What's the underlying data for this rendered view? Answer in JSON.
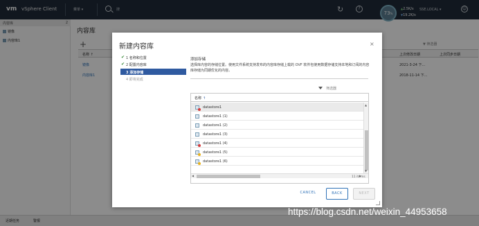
{
  "topbar": {
    "logo": "vm",
    "product": "vSphere Client",
    "menu": "菜单 ▾",
    "search_placeholder": "搜",
    "user": "SSE.LOCAL ▾",
    "help": "?",
    "refresh": "↻",
    "smiley": "☺"
  },
  "netmon": {
    "percent": "73",
    "percent_unit": "%",
    "up": "2.5K/s",
    "down": "19.2K/s"
  },
  "leftpanel": {
    "header": "内容库",
    "count": "2",
    "items": [
      {
        "label": "镜像"
      },
      {
        "label": "内容库1"
      }
    ]
  },
  "main": {
    "title": "内容库",
    "plus": "+",
    "filter": "▼ 筛选器",
    "columns": [
      "名称 ↑",
      "上次修改日期",
      "上次同步日期"
    ],
    "rows": [
      {
        "name": "镜像",
        "modified": "2021-3-24 下...",
        "synced": ""
      },
      {
        "name": "内容库1",
        "modified": "2018-11-14 下...",
        "synced": ""
      }
    ]
  },
  "bottombar": {
    "tabs": [
      "近期任务",
      "警报"
    ]
  },
  "dialog": {
    "title": "新建内容库",
    "close": "×",
    "steps": [
      {
        "label": "1 名称和位置",
        "state": "done"
      },
      {
        "label": "2 配置内容库",
        "state": "done"
      },
      {
        "label": "3 添加存储",
        "state": "active"
      },
      {
        "label": "4 即将完成",
        "state": "todo"
      }
    ],
    "section_title": "添加存储",
    "section_desc": "选择库内容的存储位置。使用文件系统支持发布的内容库存储上载的 OVF 软件包使用数据存储支持本地和订阅的内容库存储为同期优化的内容。",
    "filter_label": "筛选器",
    "grid_header": "名称",
    "grid_sort_arrow": "↑",
    "rows": [
      {
        "name": "datastore1",
        "icon": "datastore-error-icon",
        "status": "red"
      },
      {
        "name": "datastore1 (1)",
        "icon": "datastore-icon",
        "status": "ok"
      },
      {
        "name": "datastore1 (2)",
        "icon": "datastore-icon",
        "status": "ok"
      },
      {
        "name": "datastore1 (3)",
        "icon": "datastore-icon",
        "status": "ok"
      },
      {
        "name": "datastore1 (4)",
        "icon": "datastore-error-icon",
        "status": "red"
      },
      {
        "name": "datastore1 (5)",
        "icon": "datastore-warning-icon",
        "status": "yellow"
      },
      {
        "name": "datastore1 (6)",
        "icon": "datastore-warning-icon",
        "status": "yellow"
      }
    ],
    "item_count": "11 items",
    "buttons": {
      "cancel": "CANCEL",
      "back": "BACK",
      "next": "NEXT"
    }
  },
  "watermark": "https://blog.csdn.net/weixin_44953658",
  "colors": {
    "topbar": "#1f2b3a",
    "accent": "#2f5aa0",
    "link": "#2f72b7",
    "check": "#3b8b3b",
    "error": "#d63a3a",
    "warning": "#e8b21a"
  }
}
